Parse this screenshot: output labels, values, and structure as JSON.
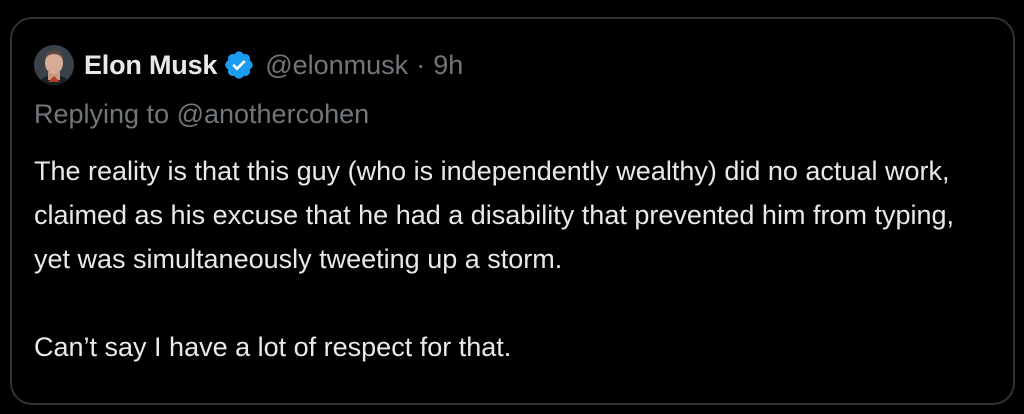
{
  "tweet": {
    "author_name": "Elon Musk",
    "author_handle": "@elonmusk",
    "separator": "·",
    "timestamp": "9h",
    "verified": true,
    "reply_context": "Replying to @anothercohen",
    "paragraphs": [
      "The reality is that this guy (who is independently wealthy) did no actual work, claimed as his excuse that he had a disability that prevented him from typing, yet was simultaneously tweeting up a storm.",
      "Can’t say I have a lot of respect for that."
    ]
  },
  "colors": {
    "background": "#000000",
    "card_border": "#2f3336",
    "primary_text": "#e7e9ea",
    "secondary_text": "#71767b",
    "verified_badge": "#1d9bf0"
  },
  "icons": {
    "verified": "verified-badge-icon",
    "avatar": "avatar"
  }
}
